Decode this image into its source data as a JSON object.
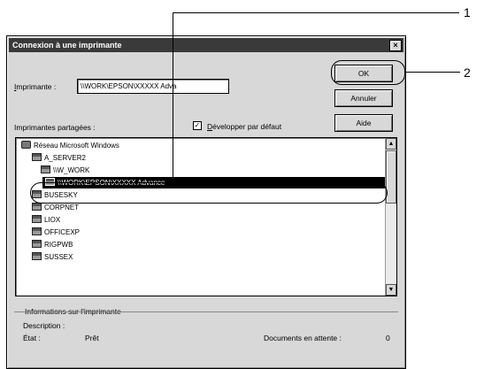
{
  "window": {
    "title": "Connexion à une imprimante",
    "close_glyph": "×"
  },
  "printer": {
    "label": "Imprimante :",
    "value": "\\\\WORK\\EPSON\\XXXXX Adva"
  },
  "buttons": {
    "ok": "OK",
    "cancel": "Annuler",
    "help": "Aide"
  },
  "shared": {
    "label": "Imprimantes partagées :",
    "expand_default_label": "Développer par défaut",
    "expand_default_checked": "✓"
  },
  "tree": {
    "items": [
      {
        "label": "Réseau Microsoft Windows",
        "icon": "network-icon"
      },
      {
        "label": "A_SERVER2",
        "icon": "computer-icon"
      },
      {
        "label": "\\\\W_WORK",
        "icon": "computer-icon"
      },
      {
        "label": "\\\\WORK\\EPSON\\XXXXX Advance",
        "icon": "printer-icon",
        "selected": true
      },
      {
        "label": "BUSESKY",
        "icon": "computer-icon"
      },
      {
        "label": "CORPNET",
        "icon": "computer-icon"
      },
      {
        "label": "LIOX",
        "icon": "computer-icon"
      },
      {
        "label": "OFFICEXP",
        "icon": "computer-icon"
      },
      {
        "label": "RIGPWB",
        "icon": "computer-icon"
      },
      {
        "label": "SUSSEX",
        "icon": "computer-icon"
      }
    ]
  },
  "info": {
    "group_label": "Informations sur l'imprimante",
    "description_label": "Description :",
    "status_label": "État :",
    "status_value": "Prêt",
    "queue_label": "Documents en attente :",
    "queue_value": "0"
  },
  "callouts": {
    "one": "1",
    "two": "2"
  },
  "scroll": {
    "up_glyph": "▲",
    "down_glyph": "▼"
  }
}
